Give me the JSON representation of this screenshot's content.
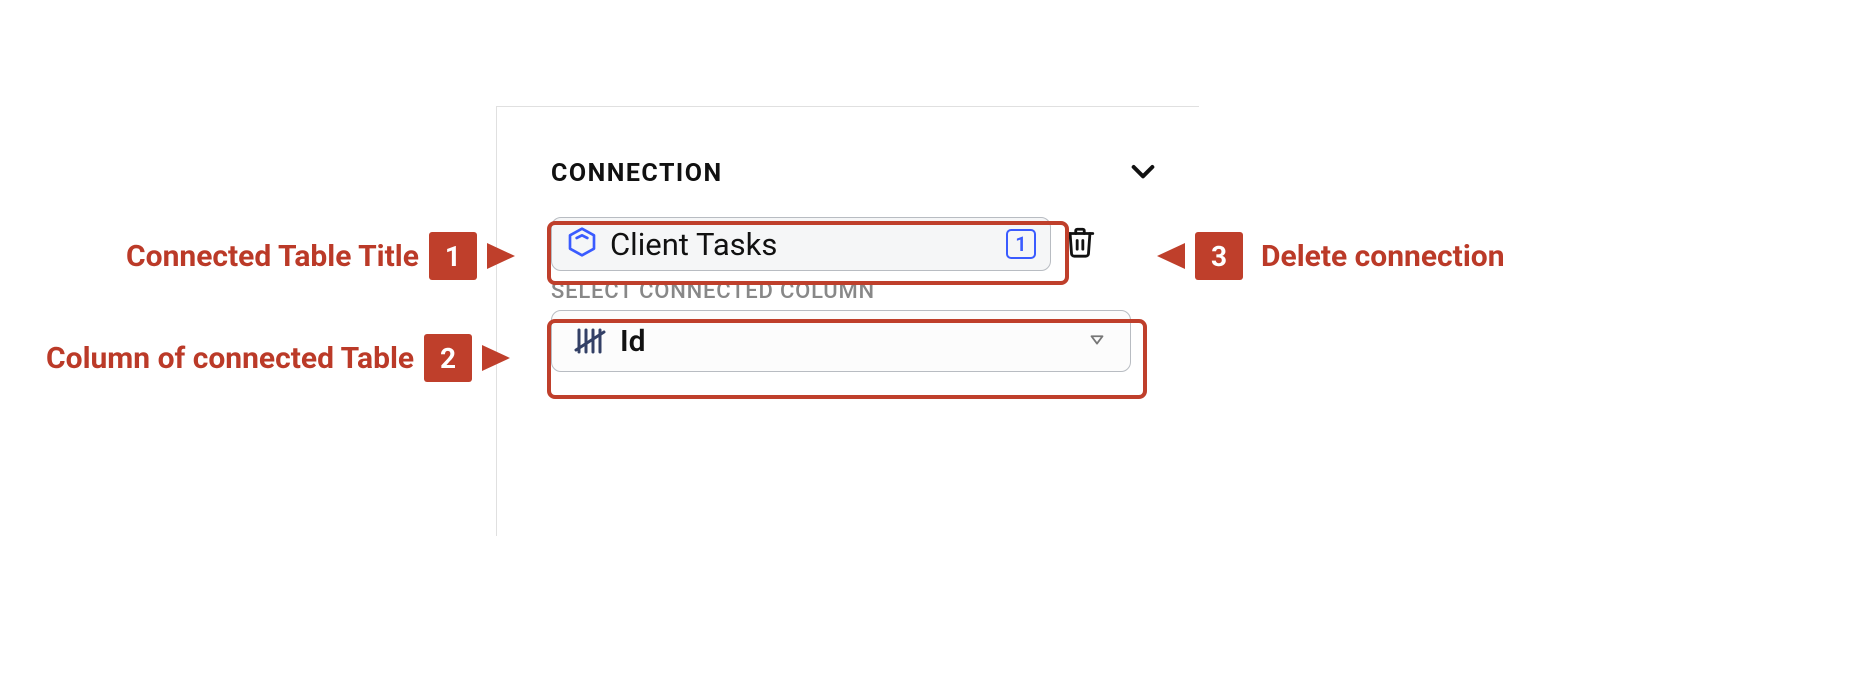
{
  "section": {
    "title": "CONNECTION"
  },
  "connected_table": {
    "name": "Client Tasks",
    "count": "1"
  },
  "column_select": {
    "label": "SELECT CONNECTED COLUMN",
    "value": "Id"
  },
  "annotations": {
    "one": {
      "num": "1",
      "text": "Connected Table Title"
    },
    "two": {
      "num": "2",
      "text": "Column of connected Table"
    },
    "three": {
      "num": "3",
      "text": "Delete connection"
    }
  }
}
